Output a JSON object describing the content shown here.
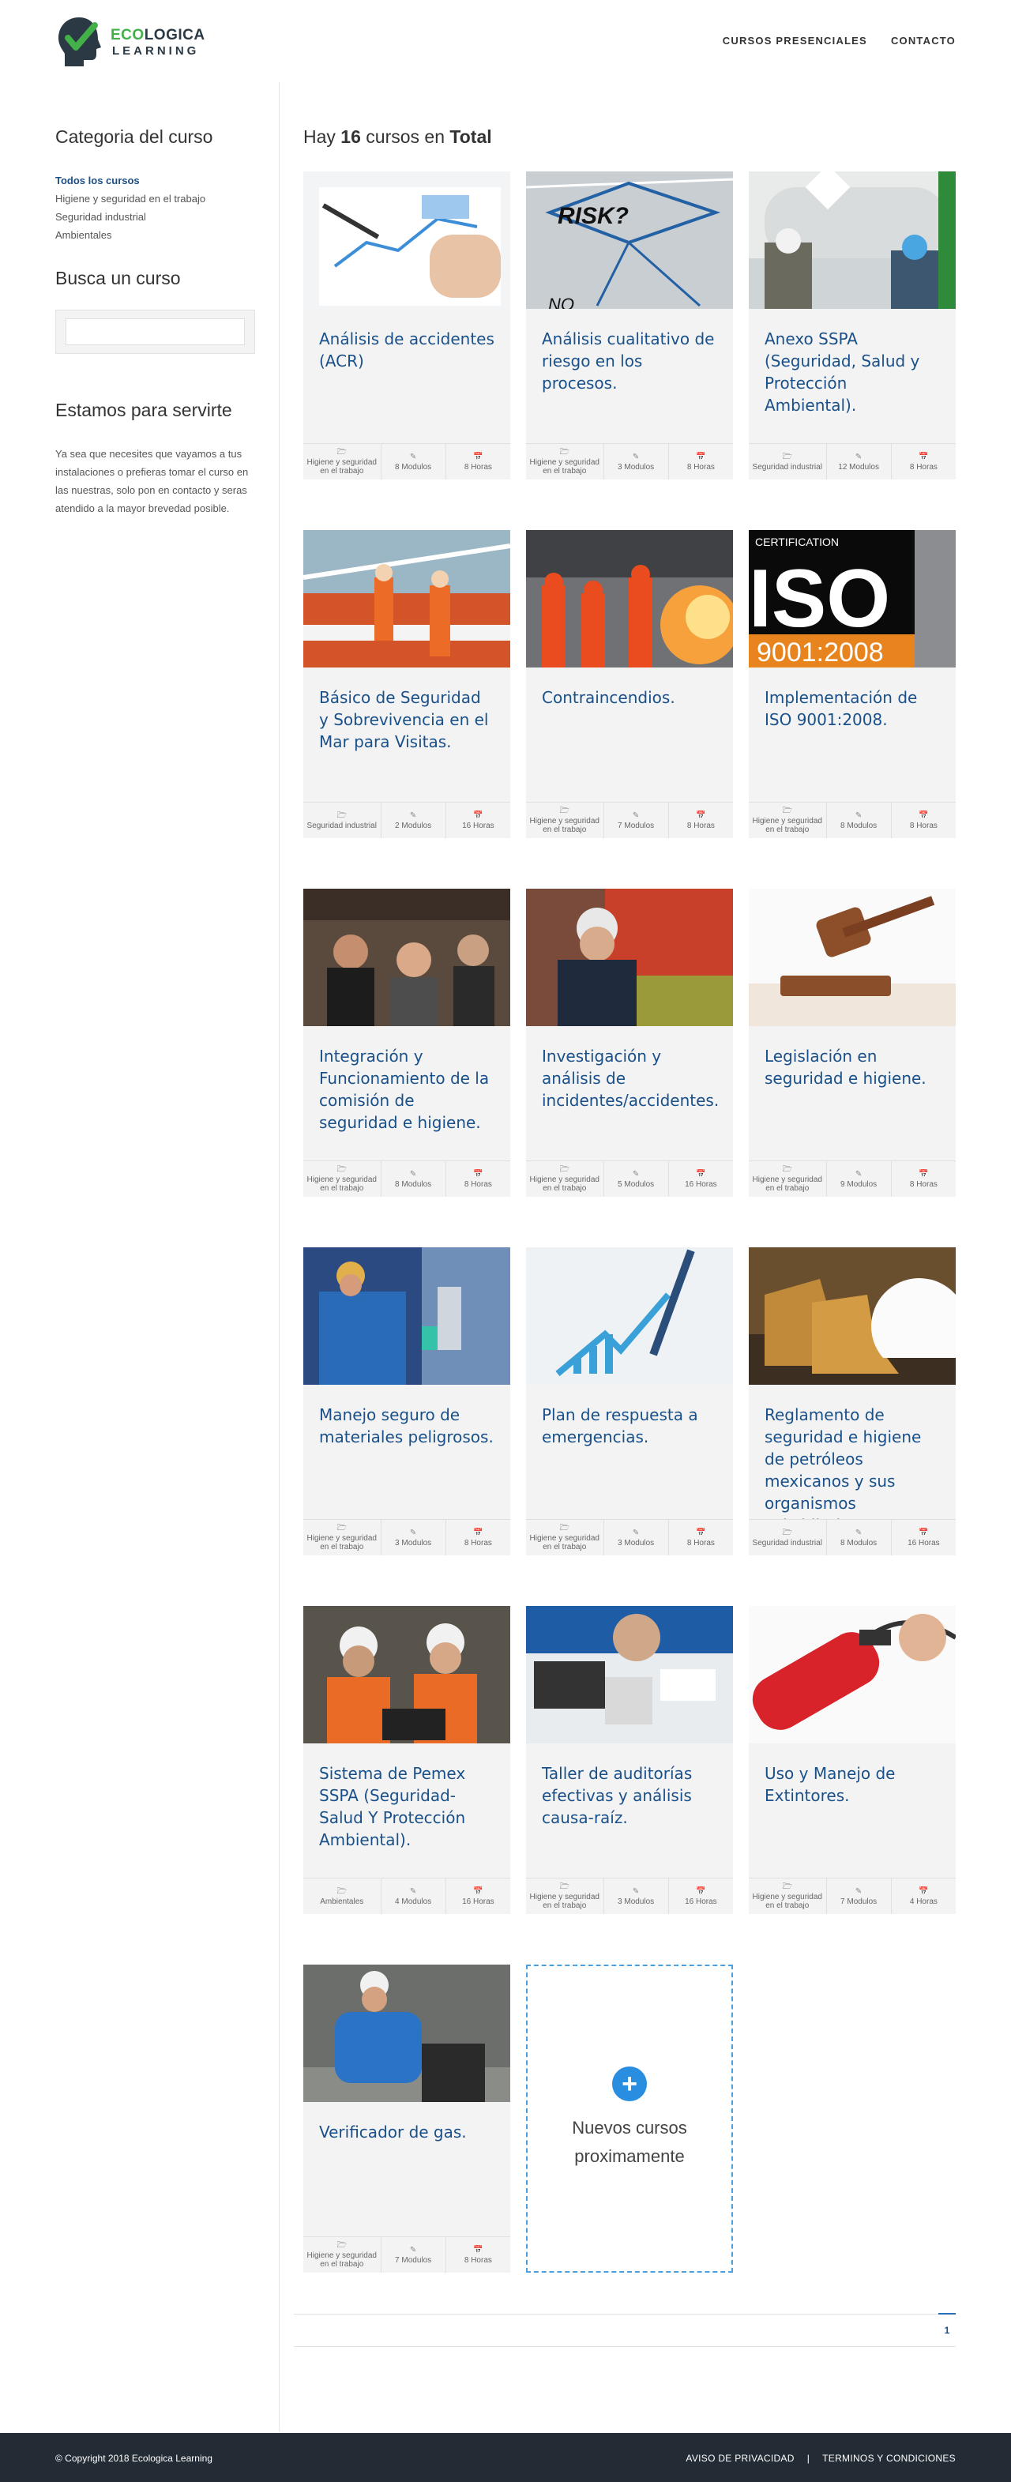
{
  "header": {
    "brand_line1_a": "ECO",
    "brand_line1_b": "LOGICA",
    "brand_line2": "LEARNING",
    "nav": [
      "CURSOS PRESENCIALES",
      "CONTACTO"
    ]
  },
  "sidebar": {
    "category_title": "Categoria del curso",
    "categories": [
      {
        "label": "Todos los cursos",
        "active": true
      },
      {
        "label": "Higiene y seguridad en el trabajo",
        "active": false
      },
      {
        "label": "Seguridad industrial",
        "active": false
      },
      {
        "label": "Ambientales",
        "active": false
      }
    ],
    "search_title": "Busca un curso",
    "search_placeholder": "",
    "about_title": "Estamos para servirte",
    "about_text": "Ya sea que necesites que vayamos a tus instalaciones o prefieras tomar el curso en las nuestras, solo pon en contacto y seras atendido a la mayor brevedad posible."
  },
  "main": {
    "total_prefix": "Hay",
    "total_count": "16",
    "total_mid": "cursos en",
    "total_suffix": "Total",
    "courses": [
      {
        "title": "Análisis de accidentes (ACR)",
        "category": "Higiene y seguridad en el trabajo",
        "modules": "8 Modulos",
        "hours": "8 Horas",
        "image": "analysis-chart"
      },
      {
        "title": "Análisis cualitativo de riesgo en los procesos.",
        "category": "Higiene y seguridad en el trabajo",
        "modules": "3 Modulos",
        "hours": "8 Horas",
        "image": "risk-diagram"
      },
      {
        "title": "Anexo SSPA (Seguridad, Salud y Protección Ambiental).",
        "category": "Seguridad industrial",
        "modules": "12 Modulos",
        "hours": "8 Horas",
        "image": "tank-workers"
      },
      {
        "title": "Básico de Seguridad y Sobrevivencia en el Mar para Visitas.",
        "category": "Seguridad industrial",
        "modules": "2 Modulos",
        "hours": "16 Horas",
        "image": "lifeboat"
      },
      {
        "title": "Contraincendios.",
        "category": "Higiene y seguridad en el trabajo",
        "modules": "7 Modulos",
        "hours": "8 Horas",
        "image": "firefighters"
      },
      {
        "title": "Implementación de ISO 9001:2008.",
        "category": "Higiene y seguridad en el trabajo",
        "modules": "8 Modulos",
        "hours": "8 Horas",
        "image": "iso-cert"
      },
      {
        "title": "Integración y Funcionamiento de la comisión de seguridad e higiene.",
        "category": "Higiene y seguridad en el trabajo",
        "modules": "8 Modulos",
        "hours": "8 Horas",
        "image": "audience"
      },
      {
        "title": "Investigación y análisis de incidentes/accidentes.",
        "category": "Higiene y seguridad en el trabajo",
        "modules": "5 Modulos",
        "hours": "16 Horas",
        "image": "inspector"
      },
      {
        "title": "Legislación en seguridad e higiene.",
        "category": "Higiene y seguridad en el trabajo",
        "modules": "9 Modulos",
        "hours": "8 Horas",
        "image": "gavel"
      },
      {
        "title": "Manejo seguro de materiales peligrosos.",
        "category": "Higiene y seguridad en el trabajo",
        "modules": "3 Modulos",
        "hours": "8 Horas",
        "image": "lab-worker"
      },
      {
        "title": "Plan de respuesta a emergencias.",
        "category": "Higiene y seguridad en el trabajo",
        "modules": "3 Modulos",
        "hours": "8 Horas",
        "image": "pen-chart"
      },
      {
        "title": "Reglamento de seguridad e higiene de petróleos mexicanos y sus organismos subsidiarios.",
        "category": "Seguridad industrial",
        "modules": "8 Modulos",
        "hours": "16 Horas",
        "image": "boots-helmet"
      },
      {
        "title": "Sistema de Pemex SSPA (Seguridad-Salud Y Protección Ambiental).",
        "category": "Ambientales",
        "modules": "4 Modulos",
        "hours": "16 Horas",
        "image": "engineers-laptop"
      },
      {
        "title": "Taller de auditorías efectivas y análisis causa-raíz.",
        "category": "Higiene y seguridad en el trabajo",
        "modules": "3 Modulos",
        "hours": "16 Horas",
        "image": "calculator-desk"
      },
      {
        "title": "Uso y Manejo de Extintores.",
        "category": "Higiene y seguridad en el trabajo",
        "modules": "7 Modulos",
        "hours": "4 Horas",
        "image": "extinguisher"
      },
      {
        "title": "Verificador de gas.",
        "category": "Higiene y seguridad en el trabajo",
        "modules": "7 Modulos",
        "hours": "8 Horas",
        "image": "gas-worker"
      }
    ],
    "new_card_text": "Nuevos cursos proximamente",
    "pagination": [
      "1"
    ]
  },
  "footer": {
    "copyright": "© Copyright 2018 Ecologica Learning",
    "links": [
      "AVISO DE PRIVACIDAD",
      "|",
      "TERMINOS Y CONDICIONES"
    ]
  },
  "colors": {
    "title_blue": "#1a5089",
    "brand_green": "#43b049",
    "footer_bg": "#232b35",
    "accent": "#2a8ee0"
  }
}
